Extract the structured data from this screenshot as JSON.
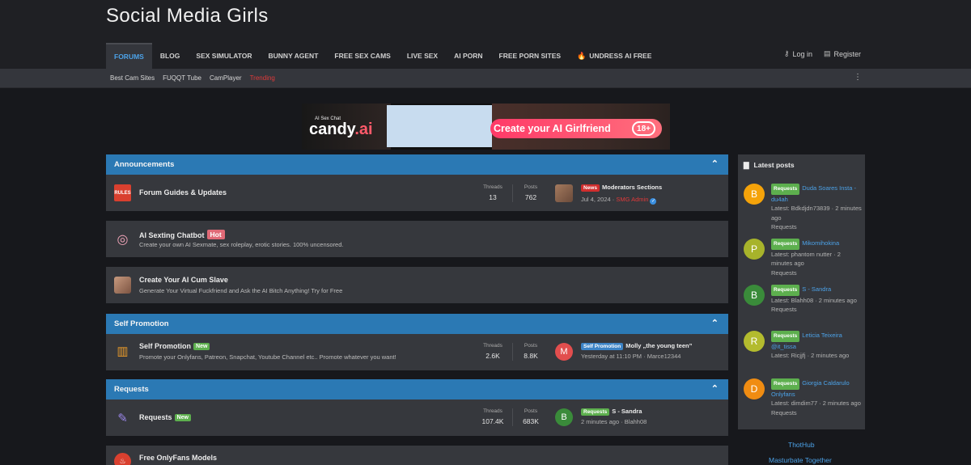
{
  "site": {
    "title": "Social Media Girls"
  },
  "nav": {
    "tabs": [
      "FORUMS",
      "BLOG",
      "SEX SIMULATOR",
      "BUNNY AGENT",
      "FREE SEX CAMS",
      "LIVE SEX",
      "AI PORN",
      "FREE PORN SITES",
      "UNDRESS AI FREE"
    ],
    "active_tab": "FORUMS",
    "login": "Log in",
    "register": "Register"
  },
  "subnav": {
    "items": [
      "Best Cam Sites",
      "FUQQT Tube",
      "CamPlayer",
      "Trending"
    ]
  },
  "banner": {
    "small_text": "AI Sex Chat",
    "brand": "candy",
    "brand_suffix": ".ai",
    "cta": "Create your AI Girlfriend",
    "badge": "18+"
  },
  "labels": {
    "threads": "Threads",
    "posts": "Posts"
  },
  "announcements": {
    "header": "Announcements",
    "node": {
      "title": "Forum Guides & Updates",
      "threads": "13",
      "posts": "762",
      "last_prefix": "News",
      "last_title": "Moderators Sections",
      "last_date": "Jul 4, 2024",
      "last_user": "SMG Admin"
    }
  },
  "promo1": {
    "title": "AI Sexting Chatbot",
    "tag": "Hot",
    "desc": "Create your own AI Sexmate, sex roleplay, erotic stories. 100% uncensored."
  },
  "promo2": {
    "title": "Create Your AI Cum Slave",
    "desc": "Generate Your Virtual Fuckfriend and Ask the AI Bitch Anything! Try for Free"
  },
  "self_promotion": {
    "header": "Self Promotion",
    "node": {
      "title": "Self Promotion",
      "tag": "New",
      "desc": "Promote your Onlyfans, Patreon, Snapchat, Youtube Channel etc.. Promote whatever you want!",
      "threads": "2.6K",
      "posts": "8.8K",
      "last_prefix": "Self Promotion",
      "last_title": "Molly „the young teen”",
      "last_date": "Yesterday at 11:10 PM",
      "last_user": "Marce12344",
      "avatar_letter": "M"
    }
  },
  "requests": {
    "header": "Requests",
    "node": {
      "title": "Requests",
      "tag": "New",
      "threads": "107.4K",
      "posts": "683K",
      "last_prefix": "Requests",
      "last_title": "S - Sandra",
      "last_date": "2 minutes ago",
      "last_user": "Blahh08",
      "avatar_letter": "B"
    }
  },
  "free_of": {
    "title": "Free OnlyFans Models"
  },
  "sidebar": {
    "title": "Latest posts",
    "items": [
      {
        "letter": "B",
        "color": "#f5a30a",
        "prefix": "Requests",
        "title": "Duda Soares Insta - du4ah",
        "latest": "Latest: Bdkdjdn73839 · 2 minutes ago",
        "forum": "Requests"
      },
      {
        "letter": "P",
        "color": "#a7b32b",
        "prefix": "Requests",
        "title": "Mikomihokina",
        "latest": "Latest: phantom nutter · 2 minutes ago",
        "forum": "Requests"
      },
      {
        "letter": "B",
        "color": "#3a8b3a",
        "prefix": "Requests",
        "title": "S - Sandra",
        "latest": "Latest: Blahh08 · 2 minutes ago",
        "forum": "Requests"
      },
      {
        "letter": "R",
        "color": "#b3bb2e",
        "prefix": "Requests",
        "title": "Leticia Teixeira @it_tissa",
        "latest": "Latest: Ricjjfj · 2 minutes ago",
        "forum": "Requests"
      },
      {
        "letter": "D",
        "color": "#f08c12",
        "prefix": "Requests",
        "title": "Giorgia Caldarulo Onlyfans",
        "latest": "Latest: dimdim77 · 2 minutes ago",
        "forum": "Requests"
      }
    ],
    "links": [
      "ThotHub",
      "Masturbate Together"
    ]
  }
}
